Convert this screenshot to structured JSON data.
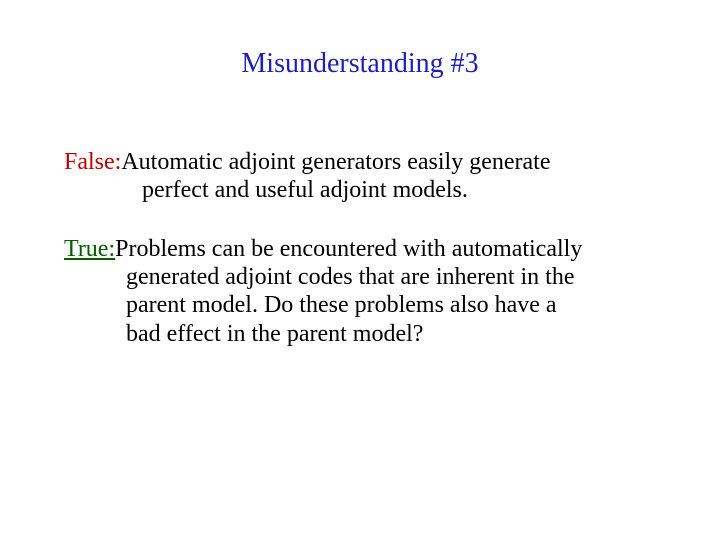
{
  "title": "Misunderstanding #3",
  "false_block": {
    "label": "False:",
    "line1": "  Automatic adjoint generators easily generate",
    "line2": "perfect and useful adjoint models."
  },
  "true_block": {
    "label": "True:",
    "line1": " Problems can be encountered with automatically",
    "line2": "generated adjoint codes that are inherent in the",
    "line3": "parent model. Do these problems also have a",
    "line4": "bad effect in the parent model?"
  }
}
